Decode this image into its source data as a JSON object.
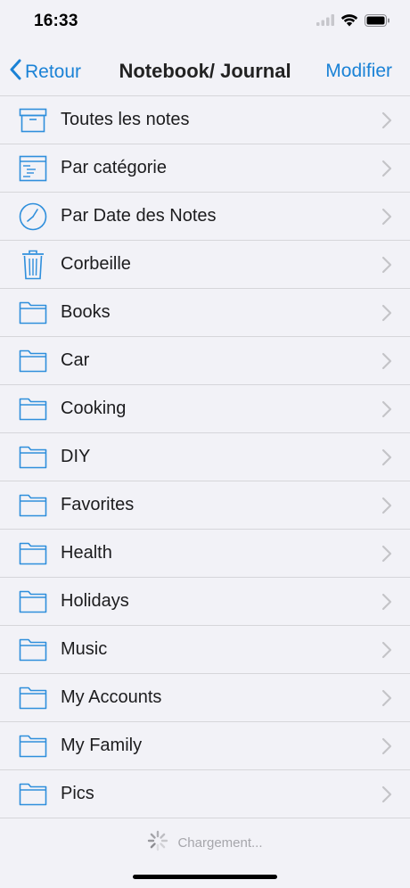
{
  "status": {
    "time": "16:33"
  },
  "nav": {
    "back_label": "Retour",
    "title": "Notebook/ Journal",
    "edit_label": "Modifier"
  },
  "items": [
    {
      "label": "Toutes les notes",
      "icon": "archive-box-icon"
    },
    {
      "label": "Par catégorie",
      "icon": "category-list-icon"
    },
    {
      "label": "Par Date des Notes",
      "icon": "clock-icon"
    },
    {
      "label": "Corbeille",
      "icon": "trash-icon"
    },
    {
      "label": "Books",
      "icon": "folder-icon"
    },
    {
      "label": "Car",
      "icon": "folder-icon"
    },
    {
      "label": "Cooking",
      "icon": "folder-icon"
    },
    {
      "label": "DIY",
      "icon": "folder-icon"
    },
    {
      "label": "Favorites",
      "icon": "folder-icon"
    },
    {
      "label": "Health",
      "icon": "folder-icon"
    },
    {
      "label": "Holidays",
      "icon": "folder-icon"
    },
    {
      "label": "Music",
      "icon": "folder-icon"
    },
    {
      "label": "My Accounts",
      "icon": "folder-icon"
    },
    {
      "label": "My Family",
      "icon": "folder-icon"
    },
    {
      "label": "Pics",
      "icon": "folder-icon"
    }
  ],
  "loading": {
    "label": "Chargement..."
  },
  "colors": {
    "accent": "#1a82d6",
    "background": "#f2f2f7",
    "separator": "#d6d6da",
    "icon_blue": "#2f8fdc"
  }
}
